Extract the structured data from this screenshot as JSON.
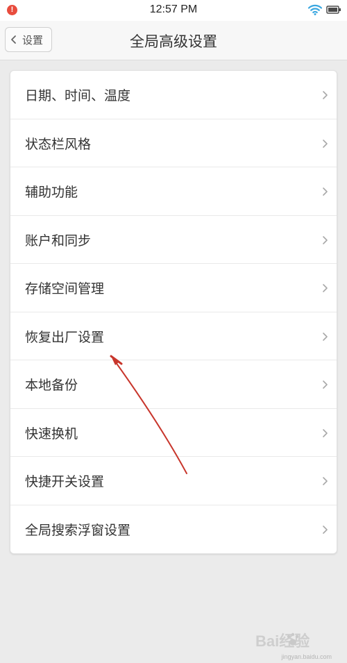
{
  "status_bar": {
    "notification_badge": "!",
    "time": "12:57 PM",
    "icons": [
      "wifi-icon",
      "battery-icon"
    ],
    "wifi_color": "#3aa7e0"
  },
  "header": {
    "back_label": "设置",
    "title": "全局高级设置"
  },
  "settings_list": {
    "items": [
      {
        "label": "日期、时间、温度"
      },
      {
        "label": "状态栏风格"
      },
      {
        "label": "辅助功能"
      },
      {
        "label": "账户和同步"
      },
      {
        "label": "存储空间管理"
      },
      {
        "label": "恢复出厂设置"
      },
      {
        "label": "本地备份"
      },
      {
        "label": "快速换机"
      },
      {
        "label": "快捷开关设置"
      },
      {
        "label": "全局搜索浮窗设置"
      }
    ]
  },
  "annotation": {
    "color": "#c8362c",
    "points_to": "恢复出厂设置"
  },
  "watermark": {
    "text": "Bai经验",
    "subtext": "jingyan.baidu.com"
  }
}
